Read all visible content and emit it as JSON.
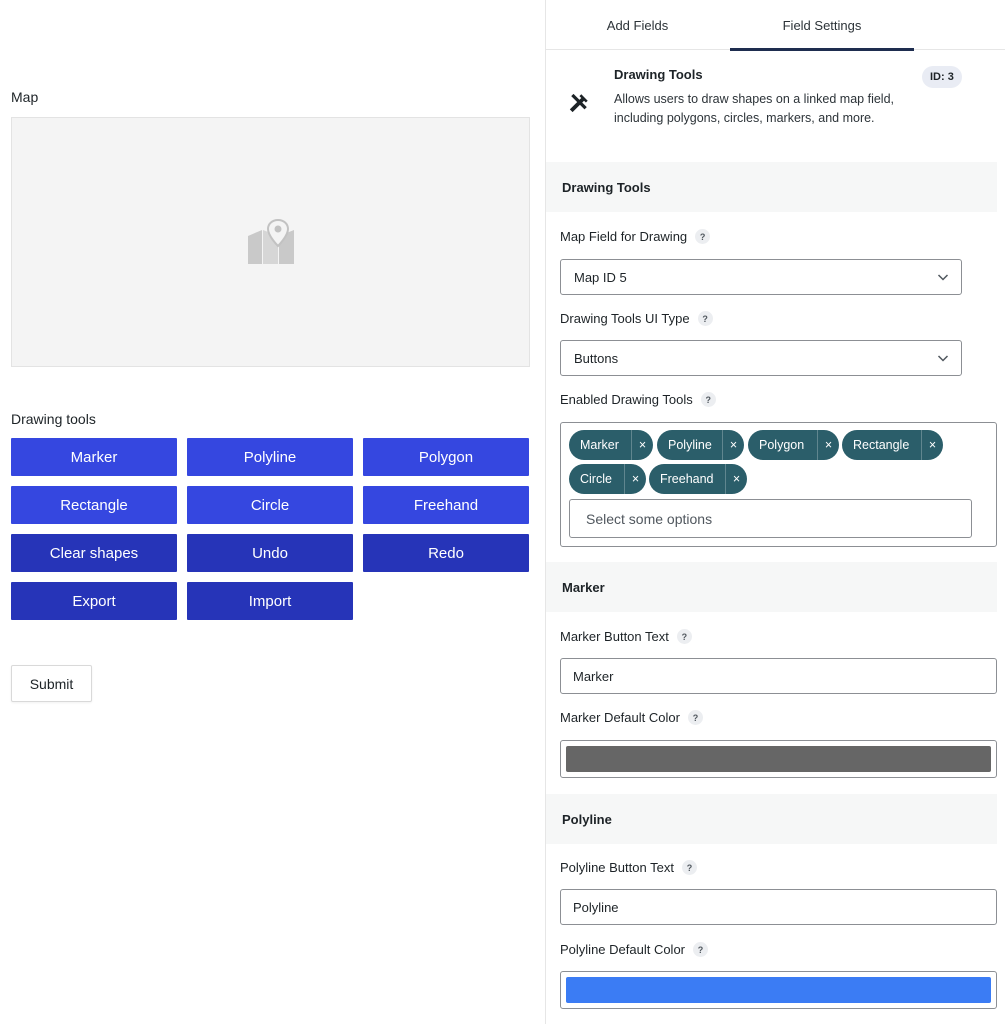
{
  "form": {
    "map_label": "Map",
    "drawing_tools_label": "Drawing tools",
    "tool_buttons": {
      "marker": "Marker",
      "polyline": "Polyline",
      "polygon": "Polygon",
      "rectangle": "Rectangle",
      "circle": "Circle",
      "freehand": "Freehand",
      "clear": "Clear shapes",
      "undo": "Undo",
      "redo": "Redo",
      "export": "Export",
      "import": "Import"
    },
    "submit_label": "Submit"
  },
  "panel": {
    "tabs": {
      "add_fields": "Add Fields",
      "field_settings": "Field Settings"
    },
    "field": {
      "icon": "hammer-wrench-icon",
      "title": "Drawing Tools",
      "description": "Allows users to draw shapes on a linked map field, including polygons, circles, markers, and more.",
      "id_badge": "ID: 3"
    },
    "sections": {
      "drawing_tools": "Drawing Tools",
      "marker": "Marker",
      "polyline": "Polyline"
    },
    "help_glyph": "?",
    "map_field": {
      "label": "Map Field for Drawing",
      "value": "Map ID 5"
    },
    "ui_type": {
      "label": "Drawing Tools UI Type",
      "value": "Buttons"
    },
    "enabled_tools": {
      "label": "Enabled Drawing Tools",
      "tags": {
        "marker": "Marker",
        "polyline": "Polyline",
        "polygon": "Polygon",
        "rectangle": "Rectangle",
        "circle": "Circle",
        "freehand": "Freehand"
      },
      "remove_glyph": "×",
      "placeholder": "Select some options"
    },
    "marker": {
      "button_text_label": "Marker Button Text",
      "button_text_value": "Marker",
      "default_color_label": "Marker Default Color",
      "default_color": "#666666"
    },
    "polyline": {
      "button_text_label": "Polyline Button Text",
      "button_text_value": "Polyline",
      "default_color_label": "Polyline Default Color",
      "default_color": "#3b7cf4"
    }
  },
  "colors": {
    "tool_button_light": "#3547e0",
    "tool_button_dark": "#2634b8",
    "tag_bg": "#2b5e6a",
    "tab_indicator": "#1e2d4f"
  }
}
